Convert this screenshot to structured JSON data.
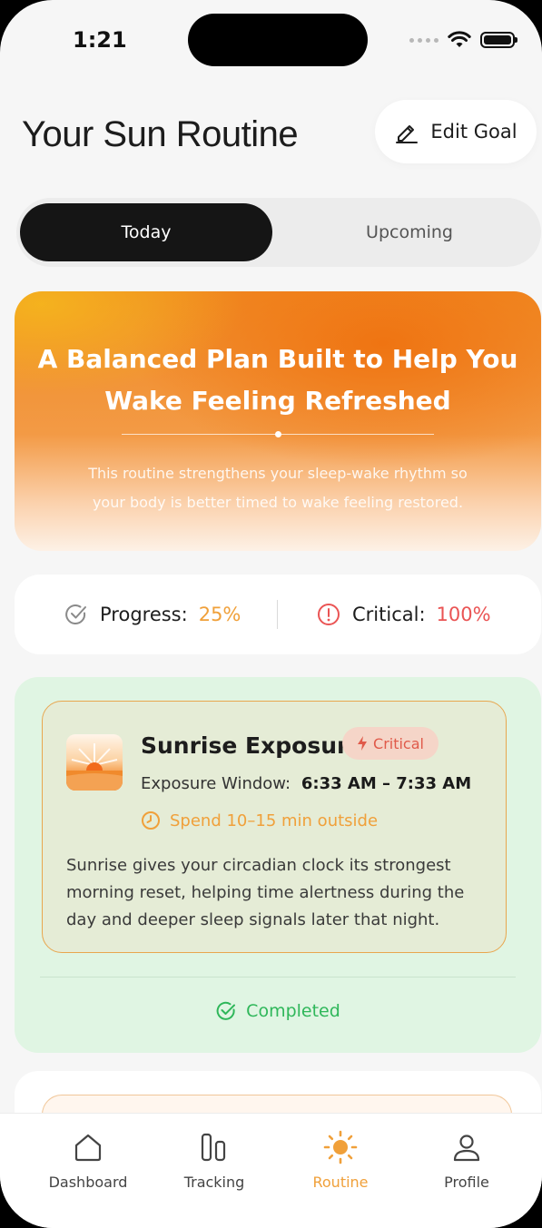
{
  "status_bar": {
    "time": "1:21"
  },
  "header": {
    "title": "Your Sun Routine",
    "edit_goal_label": "Edit Goal"
  },
  "tabs": {
    "today": "Today",
    "upcoming": "Upcoming",
    "selected": "Today"
  },
  "hero": {
    "title_line1": "A Balanced Plan Built to Help You",
    "title_line2": "Wake Feeling Refreshed",
    "subtitle_line1": "This routine strengthens your sleep-wake rhythm so",
    "subtitle_line2": "your body is better timed to wake feeling restored."
  },
  "stats": {
    "progress_label": "Progress:",
    "progress_value": "25%",
    "critical_label": "Critical:",
    "critical_value": "100%"
  },
  "task": {
    "title": "Sunrise Exposure",
    "badge": "Critical",
    "window_label": "Exposure Window:",
    "window_value": "6:33 AM – 7:33 AM",
    "spend": "Spend 10–15 min outside",
    "desc_line1": "Sunrise gives your circadian clock its strongest",
    "desc_line2": "morning reset, helping time alertness during the",
    "desc_line3": "day and deeper sleep signals later that night.",
    "status": "Completed"
  },
  "tabbar": {
    "items": [
      {
        "label": "Dashboard",
        "icon": "home-icon"
      },
      {
        "label": "Tracking",
        "icon": "bars-icon"
      },
      {
        "label": "Routine",
        "icon": "sun-icon",
        "active": true
      },
      {
        "label": "Profile",
        "icon": "person-icon"
      }
    ]
  },
  "colors": {
    "accent_orange": "#f0a03a",
    "critical_red": "#ea5454",
    "success_green": "#2fb75a",
    "dark": "#151515"
  }
}
